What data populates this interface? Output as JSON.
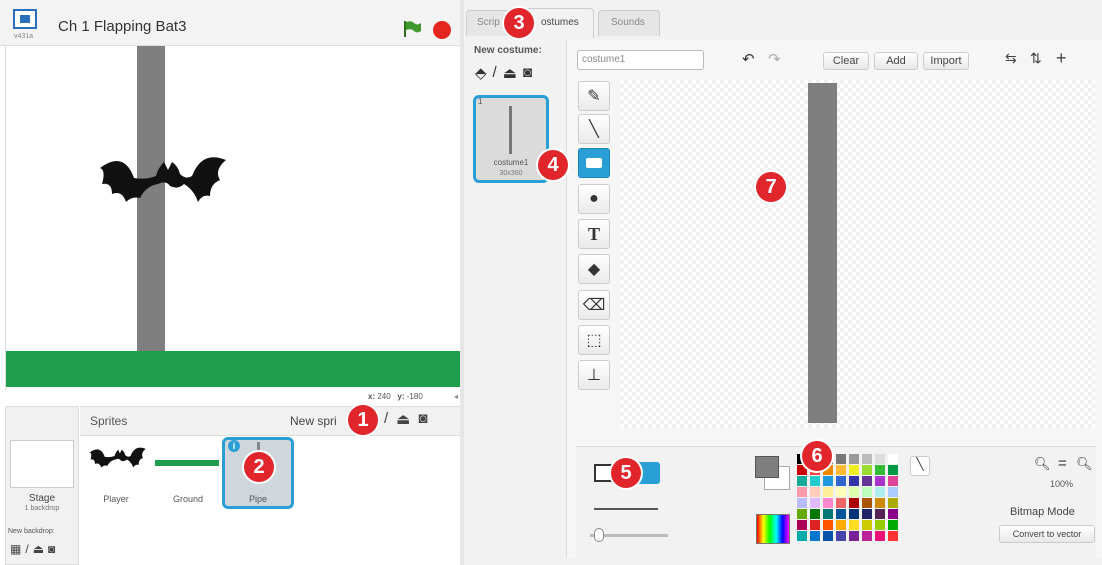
{
  "project": {
    "title": "Ch 1 Flapping Bat3",
    "version_label": "v431a"
  },
  "stage": {
    "coords": {
      "x_label": "x:",
      "x": "240",
      "y_label": "y:",
      "y": "-180"
    }
  },
  "sprites_panel": {
    "title": "Sprites",
    "new_sprite_label": "New spri",
    "stage_label": "Stage",
    "stage_backdrops": "1 backdrop",
    "new_backdrop_label": "New backdrop:",
    "sprites": [
      {
        "name": "Player"
      },
      {
        "name": "Ground"
      },
      {
        "name": "Pipe",
        "selected": true
      }
    ]
  },
  "tabs": [
    {
      "label": "Scrip"
    },
    {
      "label": "ostumes"
    },
    {
      "label": "Sounds"
    }
  ],
  "costumes": {
    "new_costume_label": "New costume:",
    "items": [
      {
        "index": "1",
        "name": "costume1",
        "size": "30x360"
      }
    ]
  },
  "editor": {
    "costume_name": "costume1",
    "buttons": {
      "clear": "Clear",
      "add": "Add",
      "import": "Import"
    },
    "zoom": "100%",
    "mode": "Bitmap Mode",
    "convert_button": "Convert to vector"
  },
  "markers": [
    "1",
    "2",
    "3",
    "4",
    "5",
    "6",
    "7"
  ],
  "colors": {
    "accent": "#2a9fd6",
    "ground": "#1e9e4e",
    "pipe": "#7f7f7f",
    "marker": "#e0262b"
  }
}
